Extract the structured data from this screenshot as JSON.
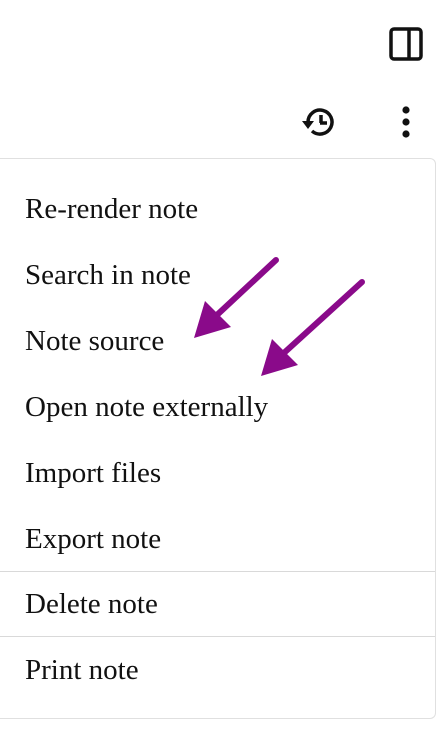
{
  "toolbar": {
    "panel_toggle_icon": "sidebar-panel-icon",
    "history_icon": "history-icon",
    "more_icon": "more-vertical-icon"
  },
  "menu": {
    "items": [
      {
        "label": "Re-render note"
      },
      {
        "label": "Search in note"
      },
      {
        "label": "Note source"
      },
      {
        "label": "Open note externally"
      },
      {
        "label": "Import files"
      },
      {
        "label": "Export note"
      },
      {
        "label": "Delete note"
      },
      {
        "label": "Print note"
      }
    ]
  },
  "colors": {
    "annotation_arrow": "#8a0a8a",
    "text": "#111111",
    "divider": "#d9d9d9"
  }
}
